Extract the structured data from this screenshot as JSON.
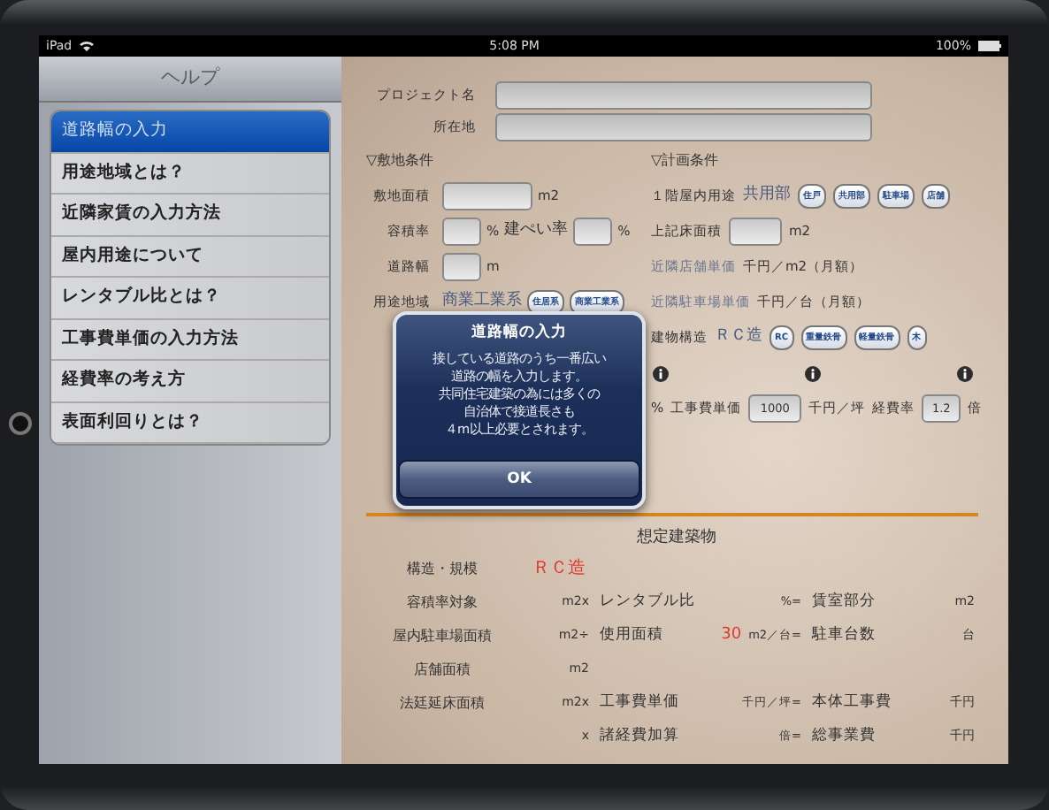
{
  "status_bar": {
    "device": "iPad",
    "time": "5:08 PM",
    "battery": "100%"
  },
  "sidebar": {
    "title": "ヘルプ",
    "items": [
      {
        "label": "道路幅の入力",
        "selected": true
      },
      {
        "label": "用途地域とは？",
        "selected": false
      },
      {
        "label": "近隣家賃の入力方法",
        "selected": false
      },
      {
        "label": "屋内用途について",
        "selected": false
      },
      {
        "label": "レンタブル比とは？",
        "selected": false
      },
      {
        "label": "工事費単価の入力方法",
        "selected": false
      },
      {
        "label": "経費率の考え方",
        "selected": false
      },
      {
        "label": "表面利回りとは？",
        "selected": false
      }
    ]
  },
  "form": {
    "project_fields": [
      {
        "label": "プロジェクト名"
      },
      {
        "label": "所在地"
      }
    ],
    "rows": [
      {
        "left": [
          {
            "kind": "heading",
            "text": "▽敷地条件"
          }
        ],
        "right": [
          {
            "kind": "heading",
            "text": "▽計画条件"
          }
        ]
      },
      {
        "left": [
          {
            "kind": "label",
            "text": "敷地面積"
          },
          {
            "kind": "wide_field"
          },
          {
            "kind": "unit",
            "text": "m2"
          }
        ],
        "right": [
          {
            "kind": "label",
            "text": "１階屋内用途"
          },
          {
            "kind": "value",
            "text": "共用部"
          },
          {
            "kind": "chip",
            "text": "住戸"
          },
          {
            "kind": "chip",
            "text": "共用部"
          },
          {
            "kind": "chip",
            "text": "駐車場"
          },
          {
            "kind": "chip",
            "text": "店舗"
          }
        ]
      },
      {
        "left": [
          {
            "kind": "label",
            "text": "容積率"
          },
          {
            "kind": "small_field"
          },
          {
            "kind": "unit",
            "text": "%"
          },
          {
            "kind": "big_label",
            "text": "建ぺい率"
          },
          {
            "kind": "small_field"
          },
          {
            "kind": "unit",
            "text": "%"
          }
        ],
        "right": [
          {
            "kind": "label",
            "text": "上記床面積"
          },
          {
            "kind": "mid_field"
          },
          {
            "kind": "unit",
            "text": "m2"
          }
        ]
      },
      {
        "left": [
          {
            "kind": "label",
            "text": "道路幅"
          },
          {
            "kind": "small_field"
          },
          {
            "kind": "unit",
            "text": "m"
          }
        ],
        "right": [
          {
            "kind": "dim_label",
            "text": "近隣店舗単価"
          },
          {
            "kind": "unit",
            "text": "千円／m2（月額）"
          }
        ]
      },
      {
        "left": [
          {
            "kind": "label",
            "text": "用途地域"
          },
          {
            "kind": "value",
            "text": "商業工業系"
          },
          {
            "kind": "chip",
            "text": "住居系"
          },
          {
            "kind": "chip",
            "text": "商業工業系"
          }
        ],
        "right": [
          {
            "kind": "dim_label",
            "text": "近隣駐車場単価"
          },
          {
            "kind": "unit",
            "text": "千円／台（月額）"
          }
        ]
      },
      {
        "left": [],
        "right": [
          {
            "kind": "label",
            "text": "建物構造"
          },
          {
            "kind": "value",
            "text": "ＲＣ造"
          },
          {
            "kind": "chip",
            "text": "RC"
          },
          {
            "kind": "chip",
            "text": "重量鉄骨"
          },
          {
            "kind": "chip",
            "text": "軽量鉄骨"
          },
          {
            "kind": "chip",
            "text": "木"
          }
        ]
      },
      {
        "left": [],
        "right": [
          {
            "kind": "info"
          },
          {
            "kind": "info"
          },
          {
            "kind": "info"
          }
        ]
      },
      {
        "left": [],
        "right": [
          {
            "kind": "unit",
            "text": "%"
          },
          {
            "kind": "label",
            "text": "工事費単価"
          },
          {
            "kind": "mid_field",
            "value": "1000"
          },
          {
            "kind": "unit",
            "text": "千円／坪"
          },
          {
            "kind": "label",
            "text": "経費率"
          },
          {
            "kind": "small_field",
            "value": "1.2"
          },
          {
            "kind": "unit",
            "text": "倍"
          }
        ]
      }
    ]
  },
  "result": {
    "title": "想定建築物",
    "rows": [
      {
        "label": "構造・規模",
        "accent": "ＲＣ造"
      },
      {
        "label": "容積率対象",
        "unit": "m2x",
        "label2": "レンタブル比",
        "unit2": "%=",
        "label3": "賃室部分",
        "unit3": "m2"
      },
      {
        "label": "屋内駐車場面積",
        "unit": "m2÷",
        "label2": "使用面積",
        "accent2": "30",
        "unit2": "m2／台=",
        "label3": "駐車台数",
        "unit3": "台"
      },
      {
        "label": "店舗面積",
        "unit": "m2"
      },
      {
        "label": "法廷延床面積",
        "unit": "m2x",
        "label2": "工事費単価",
        "unit2": "千円／坪=",
        "label3": "本体工事費",
        "unit3": "千円"
      },
      {
        "unit": "x",
        "label2": "諸経費加算",
        "unit2": "倍=",
        "label3": "総事業費",
        "unit3": "千円"
      }
    ]
  },
  "alert": {
    "title": "道路幅の入力",
    "message": [
      "接している道路のうち一番広い",
      "道路の幅を入力します。",
      "共同住宅建築の為には多くの",
      "自治体で接道長さも",
      "４m以上必要とされます。"
    ],
    "button": "OK"
  }
}
